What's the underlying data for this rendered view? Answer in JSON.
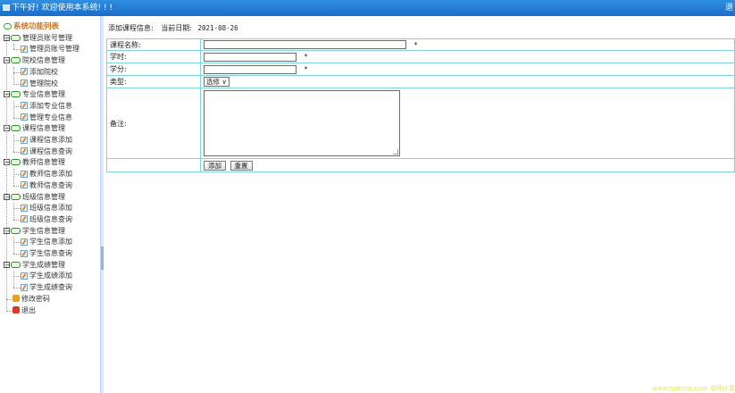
{
  "header": {
    "welcome": "下午好! 欢迎使用本系统! ! !",
    "exit_short": "退",
    "bg_color": "#1f78d1"
  },
  "sidebar": {
    "root_label": "系统功能列表",
    "groups": [
      {
        "label": "管理员账号管理",
        "items": [
          "管理员账号管理"
        ]
      },
      {
        "label": "院校信息管理",
        "items": [
          "添加院校",
          "管理院校"
        ]
      },
      {
        "label": "专业信息管理",
        "items": [
          "添加专业信息",
          "管理专业信息"
        ]
      },
      {
        "label": "课程信息管理",
        "items": [
          "课程信息添加",
          "课程信息查询"
        ]
      },
      {
        "label": "教师信息管理",
        "items": [
          "教师信息添加",
          "教师信息查询"
        ]
      },
      {
        "label": "班级信息管理",
        "items": [
          "班级信息添加",
          "班级信息查询"
        ]
      },
      {
        "label": "学生信息管理",
        "items": [
          "学生信息添加",
          "学生信息查询"
        ]
      },
      {
        "label": "学生成绩管理",
        "items": [
          "学生成绩添加",
          "学生成绩查询"
        ]
      }
    ],
    "misc_label": "修改密码",
    "exit_label": "退出"
  },
  "main": {
    "info_label": "添加课程信息:",
    "date_label": "当前日期:",
    "date_value": "2021-08-26",
    "form": {
      "course_name_label": "课程名称:",
      "hours_label": "学时:",
      "credit_label": "学分:",
      "type_label": "类型:",
      "type_selected": "选修",
      "remark_label": "备注:",
      "required_mark": "*"
    },
    "buttons": {
      "add": "添加",
      "reset": "重置"
    }
  },
  "watermark": "www.hiobtop.com 管理计算"
}
